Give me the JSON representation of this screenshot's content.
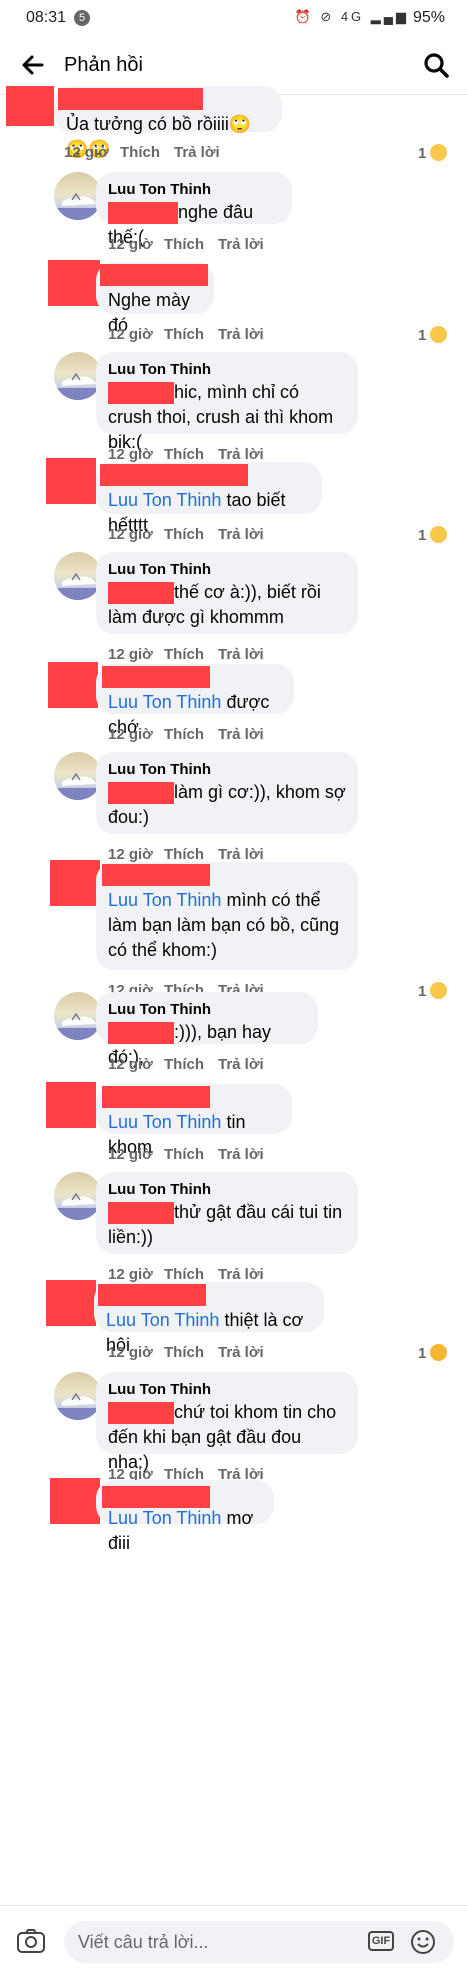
{
  "status": {
    "time": "08:31",
    "notif_count": "5",
    "signal": "4G",
    "battery": "95%"
  },
  "header": {
    "title": "Phản hồi"
  },
  "labels": {
    "like": "Thích",
    "reply": "Trả lời",
    "time": "12 giờ"
  },
  "comments": [
    {
      "text": "Ủa tưởng có bồ rồiiii🙄🙄🙄",
      "reaction_count": "1",
      "reaction": "sad"
    },
    {
      "author": "Luu Ton Thinh",
      "text": "nghe đâu thế:("
    },
    {
      "text": "Nghe mày đó",
      "reaction_count": "1",
      "reaction": "sad"
    },
    {
      "author": "Luu Ton Thinh",
      "text": "hic, mình chỉ có crush thoi, crush ai thì khom bik:("
    },
    {
      "mention": "Luu Ton Thinh",
      "text": "tao biết hếtttt",
      "reaction_count": "1",
      "reaction": "sad"
    },
    {
      "author": "Luu Ton Thinh",
      "text": "thế cơ à:)), biết rồi làm được gì khommm"
    },
    {
      "mention": "Luu Ton Thinh",
      "text": "được chớ"
    },
    {
      "author": "Luu Ton Thinh",
      "text": "làm gì cơ:)), khom sợ đou:)"
    },
    {
      "mention": "Luu Ton Thinh",
      "text": "mình có thể làm bạn làm bạn có bồ, cũng có thể khom:)",
      "reaction_count": "1",
      "reaction": "sad"
    },
    {
      "author": "Luu Ton Thinh",
      "text": ":))), bạn hay đó:),"
    },
    {
      "mention": "Luu Ton Thinh",
      "text": "tin khom"
    },
    {
      "author": "Luu Ton Thinh",
      "text": "thử gật đầu cái tui tin liền:))"
    },
    {
      "mention": "Luu Ton Thinh",
      "text": "thiệt là cơ hội",
      "reaction_count": "1",
      "reaction": "laugh"
    },
    {
      "author": "Luu Ton Thinh",
      "text": "chứ toi khom tin cho đến khi bạn gật đầu đou nha:)"
    },
    {
      "mention": "Luu Ton Thinh",
      "text": "mơ điii"
    }
  ],
  "composer": {
    "placeholder": "Viết câu trả lời...",
    "gif_label": "GIF"
  }
}
